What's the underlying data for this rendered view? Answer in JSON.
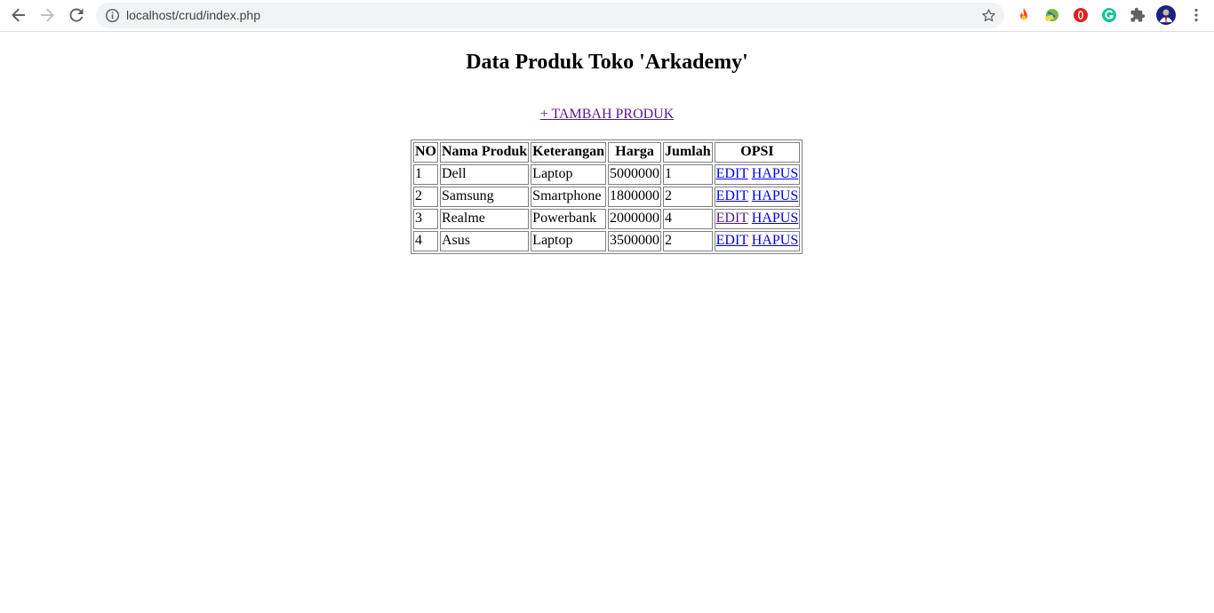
{
  "browser": {
    "url": "localhost/crud/index.php",
    "icons": [
      "back-arrow-icon",
      "forward-arrow-icon",
      "reload-icon",
      "info-icon",
      "star-icon",
      "fire-extension-icon",
      "globe-extension-icon",
      "opera-extension-icon",
      "grammarly-extension-icon",
      "puzzle-extensions-icon",
      "profile-avatar",
      "kebab-menu-icon"
    ]
  },
  "page": {
    "title": "Data Produk Toko 'Arkademy'",
    "add_link": "+ TAMBAH PRODUK"
  },
  "table": {
    "headers": [
      "NO",
      "Nama Produk",
      "Keterangan",
      "Harga",
      "Jumlah",
      "OPSI"
    ],
    "rows": [
      {
        "no": "1",
        "nama": "Dell",
        "keterangan": "Laptop",
        "harga": "5000000",
        "jumlah": "1",
        "edit": "EDIT",
        "hapus": "HAPUS"
      },
      {
        "no": "2",
        "nama": "Samsung",
        "keterangan": "Smartphone",
        "harga": "1800000",
        "jumlah": "2",
        "edit": "EDIT",
        "hapus": "HAPUS"
      },
      {
        "no": "3",
        "nama": "Realme",
        "keterangan": "Powerbank",
        "harga": "2000000",
        "jumlah": "4",
        "edit": "EDIT",
        "hapus": "HAPUS"
      },
      {
        "no": "4",
        "nama": "Asus",
        "keterangan": "Laptop",
        "harga": "3500000",
        "jumlah": "2",
        "edit": "EDIT",
        "hapus": "HAPUS"
      }
    ]
  },
  "colors": {
    "link_unvisited": "#0000ee",
    "link_visited": "#551a8b"
  }
}
